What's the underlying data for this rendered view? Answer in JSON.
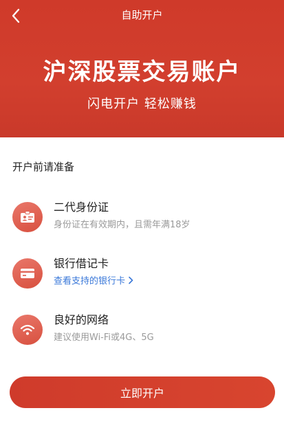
{
  "header": {
    "title": "自助开户",
    "back_icon": "chevron-left-icon"
  },
  "hero": {
    "title": "沪深股票交易账户",
    "subtitle": "闪电开户 轻松赚钱"
  },
  "prep": {
    "section_title": "开户前请准备",
    "items": [
      {
        "icon": "id-card-icon",
        "title": "二代身份证",
        "desc": "身份证在有效期内，且需年满18岁"
      },
      {
        "icon": "bank-card-icon",
        "title": "银行借记卡",
        "link": "查看支持的银行卡"
      },
      {
        "icon": "wifi-icon",
        "title": "良好的网络",
        "desc": "建议使用Wi-Fi或4G、5G"
      }
    ]
  },
  "cta": {
    "label": "立即开户"
  },
  "colors": {
    "brand_red": "#d23f2e",
    "icon_bg": "#e06a5c",
    "link_blue": "#3a78d9"
  }
}
